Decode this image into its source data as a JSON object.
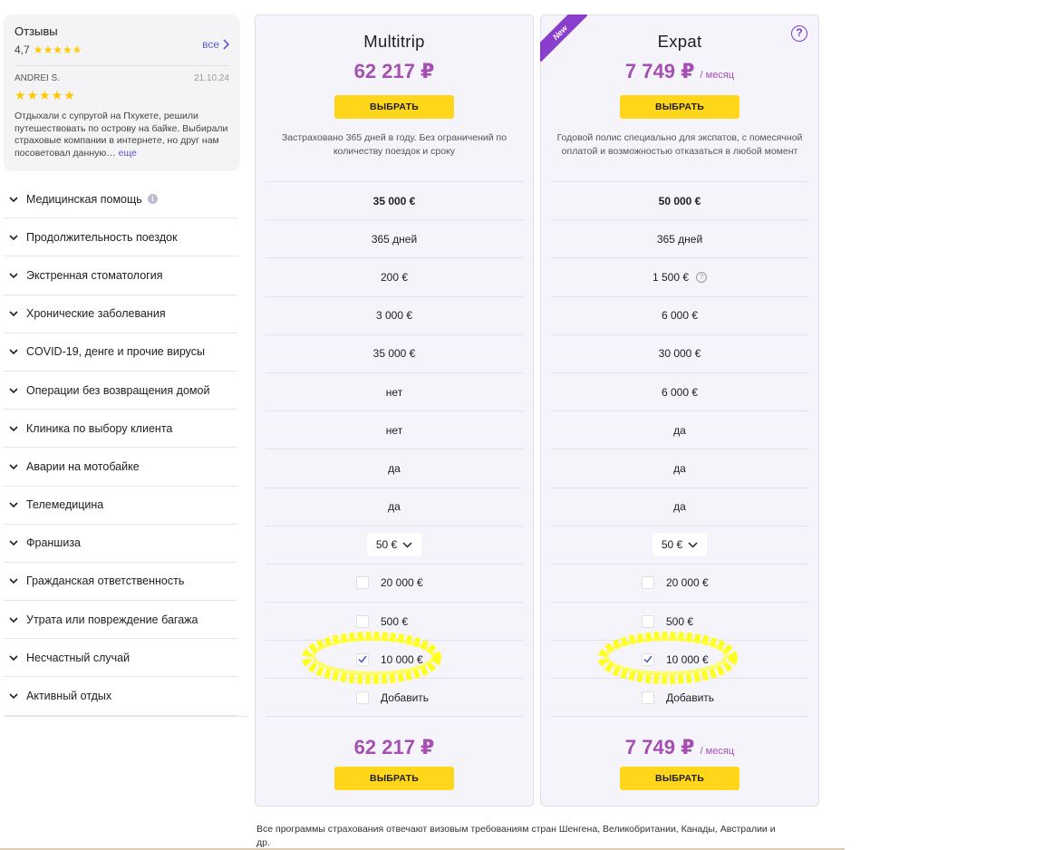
{
  "reviews": {
    "title": "Отзывы",
    "rating": "4,7",
    "all_label": "все",
    "author": "ANDREI S.",
    "date": "21.10.24",
    "text": "Отдыхали с супругой на Пхукете, решили путешествовать по острову на байке. Выбирали страховые компании в интернете, но друг нам посоветовал данную…",
    "more_label": "еще",
    "stars_color": "#ffc800"
  },
  "features": [
    {
      "label": "Медицинская помощь",
      "info": true
    },
    {
      "label": "Продолжительность поездок"
    },
    {
      "label": "Экстренная стоматология"
    },
    {
      "label": "Хронические заболевания"
    },
    {
      "label": "COVID-19, денге и прочие вирусы"
    },
    {
      "label": "Операции без возвращения домой"
    },
    {
      "label": "Клиника по выбору клиента"
    },
    {
      "label": "Аварии на мотобайке"
    },
    {
      "label": "Телемедицина"
    },
    {
      "label": "Франшиза"
    },
    {
      "label": "Гражданская ответственность"
    },
    {
      "label": "Утрата или повреждение багажа"
    },
    {
      "label": "Несчастный случай"
    },
    {
      "label": "Активный отдых"
    }
  ],
  "plans": {
    "multitrip": {
      "name": "Multitrip",
      "price": "62 217 ₽",
      "price_suffix": "",
      "button": "ВЫБРАТЬ",
      "description": "Застраховано 365 дней в году. Без ограничений по количеству поездок и сроку",
      "values": [
        "35 000 €",
        "365 дней",
        "200 €",
        "3 000 €",
        "35 000 €",
        "нет",
        "нет",
        "да",
        "да"
      ],
      "franchise": "50 €",
      "civil": "20 000 €",
      "baggage": "500 €",
      "accident": "10 000 €",
      "active": "Добавить"
    },
    "expat": {
      "name": "Expat",
      "badge": "New",
      "help": "?",
      "price": "7 749 ₽",
      "price_suffix": "/ месяц",
      "button": "ВЫБРАТЬ",
      "description": "Годовой полис специально для экспатов, с помесячной оплатой и возможностью отказаться в любой момент",
      "values": [
        "50 000 €",
        "365 дней",
        "1 500 €",
        "6 000 €",
        "30 000 €",
        "6 000 €",
        "да",
        "да",
        "да"
      ],
      "franchise": "50 €",
      "civil": "20 000 €",
      "baggage": "500 €",
      "accident": "10 000 €",
      "active": "Добавить"
    }
  },
  "footer": "Все программы страхования отвечают визовым требованиям стран Шенгена, Великобритании, Канады, Австралии и др.",
  "colors": {
    "price": "#a54fb2",
    "button": "#ffd61a",
    "link": "#5a5adb",
    "badge": "#8a3fcc",
    "highlight": "#ffff00"
  }
}
